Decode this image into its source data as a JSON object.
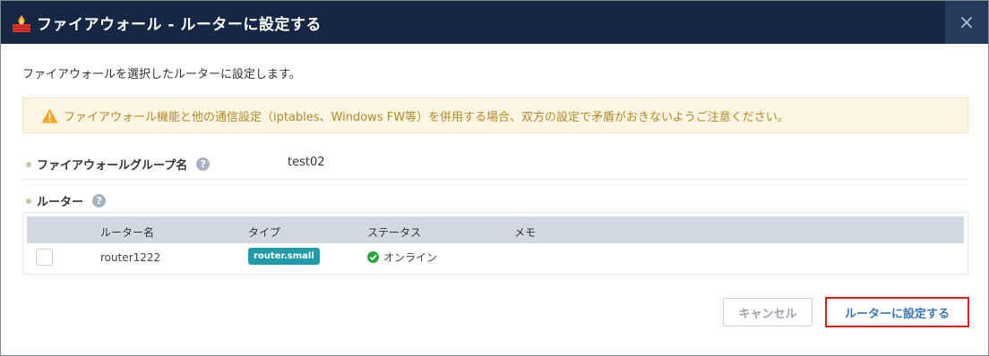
{
  "dialog": {
    "title": "ファイアウォール - ルーターに設定する",
    "close_symbol": "×",
    "header_icon": "firewall-icon",
    "description": "ファイアウォールを選択したルーターに設定します。",
    "warning": {
      "icon": "warning-icon",
      "text": "ファイアウォール機能と他の通信設定（iptables、Windows FW等）を併用する場合、双方の設定で矛盾がおきないようご注意ください。"
    },
    "group": {
      "label": "ファイアウォールグループ名",
      "value": "test02"
    },
    "router_section": {
      "label": "ルーター"
    },
    "table": {
      "columns": [
        "ルーター名",
        "タイプ",
        "ステータス",
        "メモ"
      ],
      "rows": [
        {
          "name": "router1222",
          "type": "router.small",
          "status": "オンライン",
          "memo": "",
          "checked": false
        }
      ]
    },
    "buttons": {
      "cancel": "キャンセル",
      "confirm": "ルーターに設定する"
    }
  },
  "colors": {
    "header_bg": "#152743",
    "accent": "#3a78b8",
    "badge": "#1e9aa8",
    "status_ok": "#2aa644",
    "highlight": "#e01b1b"
  }
}
